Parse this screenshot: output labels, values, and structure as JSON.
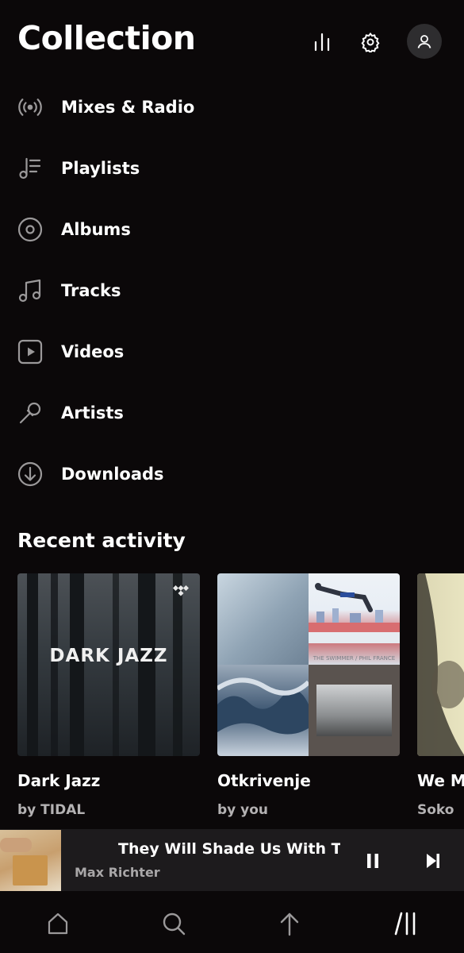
{
  "header": {
    "title": "Collection"
  },
  "menu": {
    "items": [
      {
        "label": "Mixes & Radio",
        "icon": "radio-icon"
      },
      {
        "label": "Playlists",
        "icon": "playlist-icon"
      },
      {
        "label": "Albums",
        "icon": "album-icon"
      },
      {
        "label": "Tracks",
        "icon": "music-note-icon"
      },
      {
        "label": "Videos",
        "icon": "video-icon"
      },
      {
        "label": "Artists",
        "icon": "microphone-icon"
      },
      {
        "label": "Downloads",
        "icon": "download-icon"
      }
    ]
  },
  "recent": {
    "title": "Recent activity",
    "cards": [
      {
        "title": "Dark Jazz",
        "subtitle": "by TIDAL",
        "art_text": "DARK JAZZ"
      },
      {
        "title": "Otkrivenje",
        "subtitle": "by you",
        "art_text": "THE SWIMMER / PHIL FRANCE"
      },
      {
        "title": "We M",
        "subtitle": "Soko"
      }
    ]
  },
  "now_playing": {
    "title": "They Will Shade Us With Their",
    "artist": "Max Richter"
  },
  "nav": {
    "items": [
      "home-icon",
      "search-icon",
      "upload-icon",
      "collection-icon"
    ]
  },
  "colors": {
    "background": "#0b0809",
    "player_bar": "#1d1b1d",
    "secondary_text": "#b4b2b3",
    "icon": "#9b999a"
  }
}
